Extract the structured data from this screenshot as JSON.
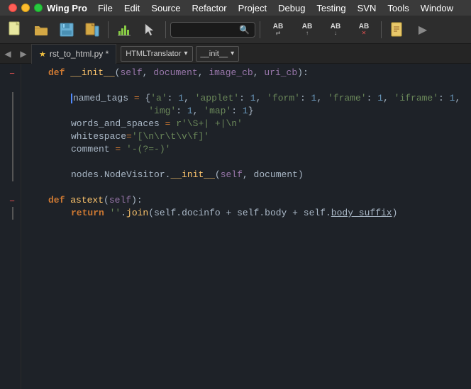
{
  "app": {
    "name": "Wing Pro"
  },
  "menu": {
    "items": [
      "File",
      "Edit",
      "Source",
      "Refactor",
      "Project",
      "Debug",
      "Testing",
      "SVN",
      "Tools",
      "Window"
    ]
  },
  "toolbar": {
    "search_placeholder": "",
    "ab_labels": [
      {
        "text": "AB",
        "arrow": "↑",
        "type": "normal"
      },
      {
        "text": "AB",
        "arrow": "↓",
        "type": "normal"
      },
      {
        "text": "AB",
        "arrow": "✕",
        "type": "red"
      }
    ]
  },
  "tab": {
    "star": "★",
    "filename": "rst_to_html.py",
    "modified": "*",
    "translator": "HTMLTranslator",
    "function": "__init__"
  },
  "code": {
    "lines": [
      {
        "indent": 1,
        "content": "def __init__(self, document, image_cb, uri_cb):"
      },
      {
        "indent": 0,
        "content": ""
      },
      {
        "indent": 2,
        "content": "named_tags = {'a': 1, 'applet': 1, 'form': 1, 'frame': 1, 'iframe': 1,"
      },
      {
        "indent": 2,
        "content": "              'img': 1, 'map': 1}"
      },
      {
        "indent": 2,
        "content": "words_and_spaces = r'\\S+| +|\\n'"
      },
      {
        "indent": 2,
        "content": "whitespace='[\\n\\r\\t\\v\\f]'"
      },
      {
        "indent": 2,
        "content": "comment = '-(?=-)' "
      },
      {
        "indent": 0,
        "content": ""
      },
      {
        "indent": 2,
        "content": "nodes.NodeVisitor.__init__(self, document)"
      },
      {
        "indent": 0,
        "content": ""
      },
      {
        "indent": 1,
        "content": "def astext(self):"
      },
      {
        "indent": 2,
        "content": "return ''.join(self.docinfo + self.body + self.body_suffix)"
      }
    ]
  }
}
